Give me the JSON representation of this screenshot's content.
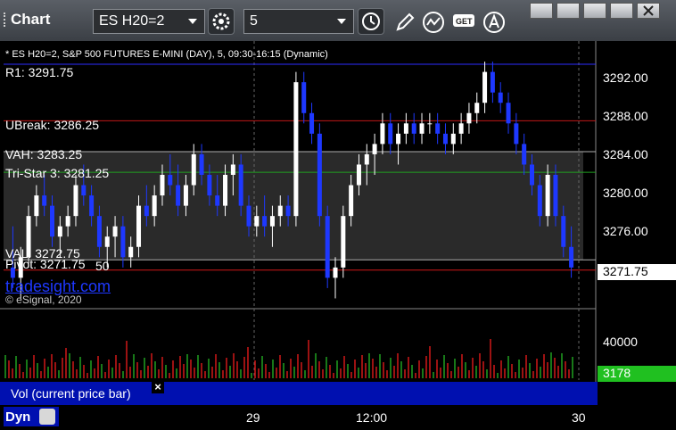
{
  "app": {
    "title": "Chart"
  },
  "toolbar": {
    "symbol": "ES H20=2",
    "interval": "5"
  },
  "header": {
    "description": "* ES H20=2, S&P 500 FUTURES E-MINI (DAY), 5, 09:30-16:15 (Dynamic)"
  },
  "levels": {
    "r1": "R1: 3291.75",
    "ubreak": "UBreak: 3286.25",
    "vah": "VAH: 3283.25",
    "tristar": "Tri-Star 3: 3281.25",
    "val": "VAL: 3272.75",
    "pivot": "Pivot: 3271.75",
    "pivot_suffix": "50"
  },
  "watermark": {
    "brand": "tradesight.com",
    "copyright": "© eSignal, 2020"
  },
  "y_axis": {
    "ticks": [
      "3292.00",
      "3288.00",
      "3284.00",
      "3280.00",
      "3276.00"
    ],
    "last_price": "3271.75"
  },
  "volume": {
    "tick": "40000",
    "current": "3178",
    "legend": "Vol (current price bar)"
  },
  "x_axis": {
    "labels": [
      "29",
      "12:00",
      "30"
    ],
    "left_label": "Dyn"
  },
  "colors": {
    "up": "#ffffff",
    "down": "#1e38ff",
    "r1": "#2b2bff",
    "ubreak": "#c01818",
    "vah": "#b0b0b0",
    "tristar": "#20a020",
    "pivot": "#d01818",
    "vol_up": "#20a020",
    "vol_down": "#d01818",
    "accent": "#20c020"
  },
  "chart_data": {
    "type": "candlestick",
    "y_range": [
      3268,
      3294
    ],
    "candles": [
      [
        3272,
        3276,
        3270,
        3271
      ],
      [
        3271,
        3274,
        3269,
        3273
      ],
      [
        3273,
        3278,
        3272,
        3277
      ],
      [
        3277,
        3280,
        3276,
        3279
      ],
      [
        3279,
        3281,
        3277,
        3278
      ],
      [
        3278,
        3279,
        3274,
        3275
      ],
      [
        3275,
        3277,
        3273,
        3276
      ],
      [
        3276,
        3278,
        3275,
        3277
      ],
      [
        3277,
        3281,
        3276,
        3280
      ],
      [
        3280,
        3282,
        3278,
        3279
      ],
      [
        3279,
        3280,
        3276,
        3277
      ],
      [
        3277,
        3278,
        3273,
        3274
      ],
      [
        3274,
        3276,
        3272,
        3275
      ],
      [
        3275,
        3277,
        3273,
        3276
      ],
      [
        3276,
        3277,
        3272,
        3273
      ],
      [
        3273,
        3275,
        3272,
        3274
      ],
      [
        3274,
        3279,
        3273,
        3278
      ],
      [
        3278,
        3280,
        3276,
        3277
      ],
      [
        3277,
        3280,
        3276,
        3279
      ],
      [
        3279,
        3282,
        3278,
        3281
      ],
      [
        3281,
        3283,
        3279,
        3280
      ],
      [
        3280,
        3282,
        3277,
        3278
      ],
      [
        3278,
        3281,
        3277,
        3280
      ],
      [
        3280,
        3284,
        3279,
        3283
      ],
      [
        3283,
        3284,
        3280,
        3281
      ],
      [
        3281,
        3282,
        3278,
        3279
      ],
      [
        3279,
        3281,
        3277,
        3278
      ],
      [
        3278,
        3282,
        3277,
        3281
      ],
      [
        3281,
        3283,
        3279,
        3282
      ],
      [
        3282,
        3283,
        3277,
        3278
      ],
      [
        3278,
        3279,
        3275,
        3276
      ],
      [
        3276,
        3278,
        3275,
        3277
      ],
      [
        3277,
        3279,
        3275,
        3276
      ],
      [
        3276,
        3278,
        3274,
        3277
      ],
      [
        3277,
        3279,
        3276,
        3278
      ],
      [
        3278,
        3279,
        3276,
        3277
      ],
      [
        3277,
        3291,
        3276,
        3290
      ],
      [
        3290,
        3291,
        3286,
        3287
      ],
      [
        3287,
        3288,
        3284,
        3285
      ],
      [
        3285,
        3286,
        3276,
        3277
      ],
      [
        3277,
        3278,
        3270,
        3271
      ],
      [
        3271,
        3273,
        3269,
        3272
      ],
      [
        3272,
        3278,
        3271,
        3277
      ],
      [
        3277,
        3281,
        3276,
        3280
      ],
      [
        3280,
        3283,
        3279,
        3282
      ],
      [
        3282,
        3284,
        3280,
        3283
      ],
      [
        3283,
        3285,
        3281,
        3284
      ],
      [
        3284,
        3287,
        3283,
        3286
      ],
      [
        3286,
        3287,
        3283,
        3284
      ],
      [
        3284,
        3286,
        3282,
        3285
      ],
      [
        3285,
        3287,
        3284,
        3286
      ],
      [
        3286,
        3287,
        3284,
        3285
      ],
      [
        3285,
        3287,
        3284,
        3286
      ],
      [
        3286,
        3287,
        3285,
        3286
      ],
      [
        3286,
        3287,
        3284,
        3285
      ],
      [
        3285,
        3286,
        3283,
        3284
      ],
      [
        3284,
        3286,
        3283,
        3285
      ],
      [
        3285,
        3287,
        3284,
        3286
      ],
      [
        3286,
        3288,
        3285,
        3287
      ],
      [
        3287,
        3289,
        3286,
        3288
      ],
      [
        3288,
        3292,
        3287,
        3291
      ],
      [
        3291,
        3292,
        3288,
        3289
      ],
      [
        3289,
        3290,
        3287,
        3288
      ],
      [
        3288,
        3289,
        3285,
        3286
      ],
      [
        3286,
        3287,
        3283,
        3284
      ],
      [
        3284,
        3285,
        3281,
        3282
      ],
      [
        3282,
        3283,
        3279,
        3280
      ],
      [
        3280,
        3281,
        3276,
        3277
      ],
      [
        3277,
        3282,
        3276,
        3281
      ],
      [
        3281,
        3282,
        3276,
        3277
      ],
      [
        3277,
        3278,
        3273,
        3274
      ],
      [
        3274,
        3276,
        3271,
        3272
      ]
    ],
    "volume_range": [
      0,
      50000
    ]
  }
}
